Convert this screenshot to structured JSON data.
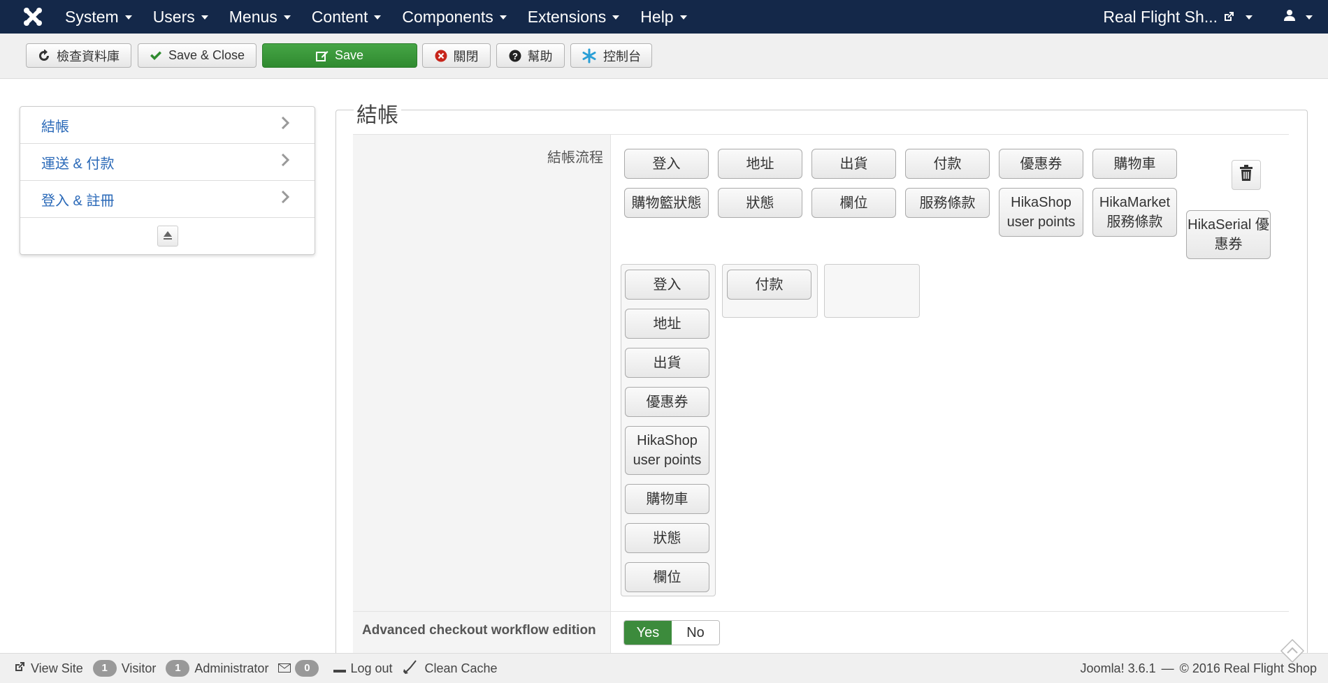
{
  "navbar": {
    "brand_icon": "joomla-logo-icon",
    "menus": [
      "System",
      "Users",
      "Menus",
      "Content",
      "Components",
      "Extensions",
      "Help"
    ],
    "site_name": "Real Flight Sh...",
    "user_icon": "user-icon"
  },
  "toolbar": {
    "check_db": "檢查資料庫",
    "save_close": "Save & Close",
    "save": "Save",
    "close": "關閉",
    "help": "幫助",
    "dashboard": "控制台"
  },
  "sidebar": {
    "items": [
      {
        "label": "結帳"
      },
      {
        "label": "運送 & 付款"
      },
      {
        "label": "登入 & 註冊"
      }
    ]
  },
  "main": {
    "legend": "結帳",
    "workflow_label": "結帳流程",
    "available_blocks": [
      "登入",
      "地址",
      "出貨",
      "付款",
      "優惠券",
      "購物車",
      "購物籃狀態",
      "狀態",
      "欄位",
      "服務條款",
      "HikaShop user points",
      "HikaMarket 服務條款",
      "HikaSerial 優惠券"
    ],
    "step1_blocks": [
      "登入",
      "地址",
      "出貨",
      "優惠券",
      "HikaShop user points",
      "購物車",
      "狀態",
      "欄位"
    ],
    "step2_blocks": [
      "付款"
    ],
    "advanced_label": "Advanced checkout workflow edition",
    "yes": "Yes",
    "no": "No"
  },
  "footer": {
    "view_site": "View Site",
    "visitor_count": "1",
    "visitor_label": "Visitor",
    "admin_count": "1",
    "admin_label": "Administrator",
    "message_count": "0",
    "logout": "Log out",
    "clean_cache": "Clean Cache",
    "version": "Joomla! 3.6.1",
    "separator": "—",
    "copyright": "© 2016 Real Flight Shop"
  },
  "colors": {
    "navbar_bg": "#142849",
    "save_green": "#46a546",
    "link_blue": "#2a69b8",
    "yes_green": "#3c8b3c"
  }
}
